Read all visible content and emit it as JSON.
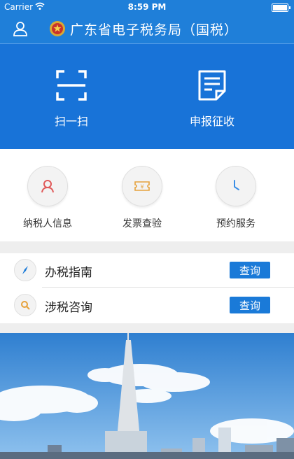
{
  "status_bar": {
    "carrier": "Carrier",
    "time": "8:59 PM"
  },
  "navbar": {
    "title": "广东省电子税务局（国税）"
  },
  "hero_actions": [
    {
      "label": "扫一扫",
      "icon": "scan-icon"
    },
    {
      "label": "申报征收",
      "icon": "document-icon"
    }
  ],
  "quick_services": [
    {
      "label": "纳税人信息",
      "icon": "user-icon"
    },
    {
      "label": "发票查验",
      "icon": "invoice-icon"
    },
    {
      "label": "预约服务",
      "icon": "clock-icon"
    }
  ],
  "list_rows": [
    {
      "label": "办税指南",
      "button": "查询",
      "icon": "compass-icon"
    },
    {
      "label": "涉税咨询",
      "button": "查询",
      "icon": "search-icon"
    }
  ],
  "colors": {
    "primary_blue": "#1873d8",
    "button_blue": "#1a7ad8",
    "user_icon": "#e05a5a",
    "invoice_icon": "#e6a23c",
    "clock_icon": "#3a8ee6",
    "search_icon": "#e6a23c"
  }
}
